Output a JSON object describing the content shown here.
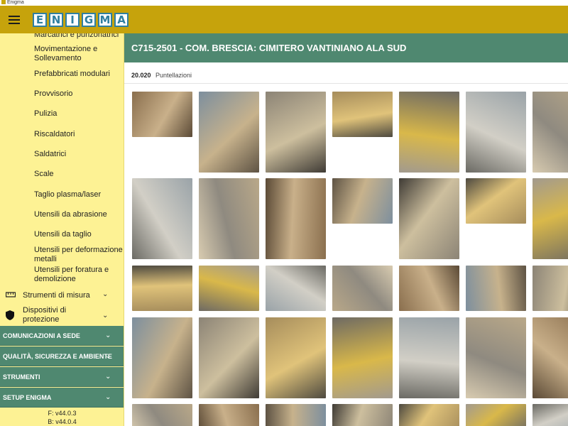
{
  "window": {
    "title": "Enigma"
  },
  "header": {
    "logo_letters": [
      "E",
      "N",
      "I",
      "G",
      "M",
      "A"
    ]
  },
  "sidebar": {
    "sub_items": [
      "Marcatrici e punzonatrici",
      "Movimentazione e Sollevamento",
      "Prefabbricati modulari",
      "Provvisorio",
      "Pulizia",
      "Riscaldatori",
      "Saldatrici",
      "Scale",
      "Taglio plasma/laser",
      "Utensili da abrasione",
      "Utensili da taglio",
      "Utensili per deformazione metalli",
      "Utensili per foratura e demolizione"
    ],
    "groups": [
      {
        "label": "Strumenti di misura",
        "icon": "ruler-icon"
      },
      {
        "label": "Dispositivi di protezione",
        "icon": "shield-icon"
      }
    ],
    "sections": [
      "COMUNICAZIONI A SEDE",
      "QUALITÀ, SICUREZZA E AMBIENTE",
      "STRUMENTI",
      "SETUP ENIGMA"
    ],
    "versions": [
      "F: v44.0.3",
      "B: v44.0.4"
    ]
  },
  "main": {
    "title": "C715-2501 - COM. BRESCIA: CIMITERO VANTINIANO ALA SUD",
    "category_code": "20.020",
    "category_name": "Puntellazioni"
  },
  "colors": {
    "topbar": "#c6a30c",
    "sidebar": "#fdf294",
    "accent_green": "#4f8870",
    "logo_blue": "#2f7fa0"
  },
  "photos_count": 35
}
